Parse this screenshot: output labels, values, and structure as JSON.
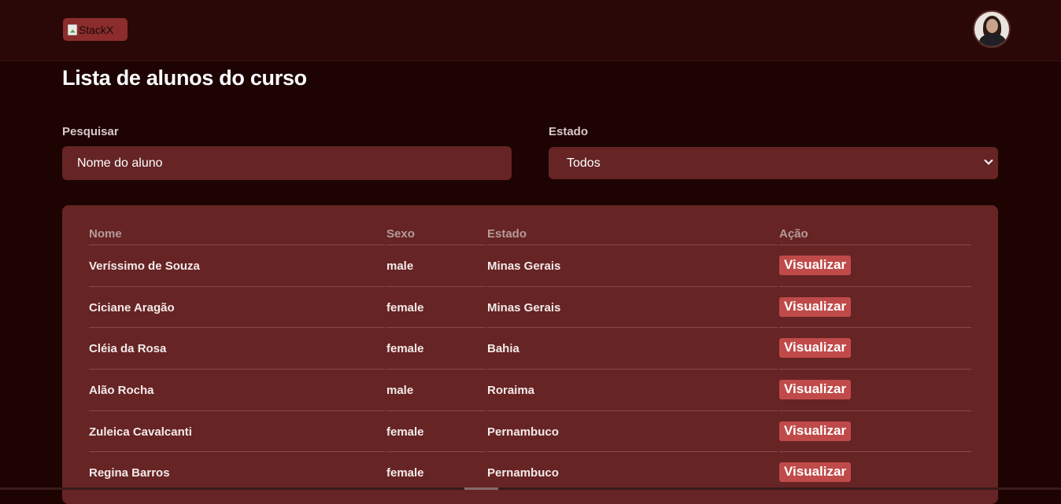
{
  "header": {
    "logo_alt": "StackX",
    "avatar_icon": "user-avatar-icon"
  },
  "main": {
    "title": "Lista de alunos do curso",
    "search": {
      "label": "Pesquisar",
      "placeholder": "Nome do aluno"
    },
    "state_filter": {
      "label": "Estado",
      "selected": "Todos",
      "icon": "chevron-down-icon"
    }
  },
  "table": {
    "columns": [
      "Nome",
      "Sexo",
      "Estado",
      "Ação"
    ],
    "rows": [
      {
        "nome": "Veríssimo de Souza",
        "sexo": "male",
        "estado": "Minas Gerais",
        "acao": "Visualizar"
      },
      {
        "nome": "Ciciane Aragão",
        "sexo": "female",
        "estado": "Minas Gerais",
        "acao": "Visualizar"
      },
      {
        "nome": "Cléia da Rosa",
        "sexo": "female",
        "estado": "Bahia",
        "acao": "Visualizar"
      },
      {
        "nome": "Alão Rocha",
        "sexo": "male",
        "estado": "Roraima",
        "acao": "Visualizar"
      },
      {
        "nome": "Zuleica Cavalcanti",
        "sexo": "female",
        "estado": "Pernambuco",
        "acao": "Visualizar"
      },
      {
        "nome": "Regina Barros",
        "sexo": "female",
        "estado": "Pernambuco",
        "acao": "Visualizar"
      }
    ]
  },
  "colors": {
    "background": "#1e0303",
    "topbar": "#2a0808",
    "surface": "#662424",
    "accent": "#c04a4a"
  }
}
